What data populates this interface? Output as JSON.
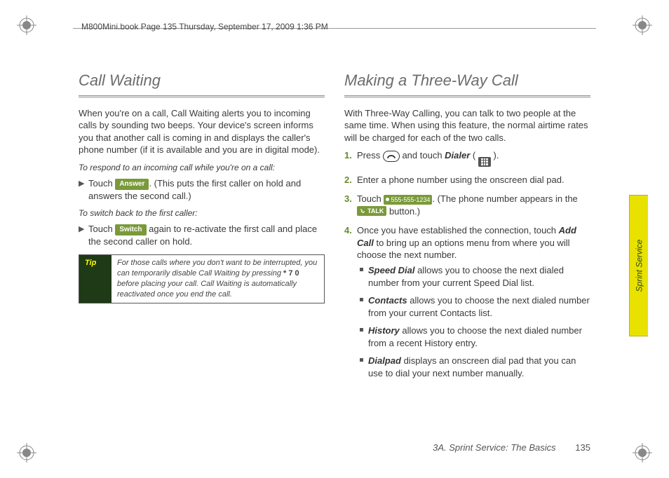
{
  "header": {
    "filename_line": "M800Mini.book  Page 135  Thursday, September 17, 2009  1:36 PM"
  },
  "side_tab": "Sprint Service",
  "footer": {
    "section": "3A. Sprint Service: The Basics",
    "page_no": "135"
  },
  "left": {
    "title": "Call Waiting",
    "intro": "When you're on a call, Call Waiting alerts you to incoming calls by sounding two beeps. Your device's screen informs you that another call is coming in and displays the caller's phone number (if it is available and you are in digital mode).",
    "sub1": "To respond to an incoming call while you're on a call:",
    "b1_a": "Touch ",
    "b1_btn": "Answer",
    "b1_b": ". (This puts the first caller on hold and answers the second call.)",
    "sub2": "To switch back to the first caller:",
    "b2_a": "Touch ",
    "b2_btn": "Switch",
    "b2_b": " again to re-activate the first call and place the second caller on hold.",
    "tip_label": "Tip",
    "tip_a": "For those calls where you don't want to be interrupted, you can temporarily disable Call Waiting by pressing ",
    "tip_code": "* 7 0",
    "tip_b": " before placing your call. Call Waiting is automatically reactivated once you end the call."
  },
  "right": {
    "title": "Making a Three-Way Call",
    "intro": "With Three-Way Calling, you can talk to two people at the same time. When using this feature, the normal airtime rates will be charged for each of the two calls.",
    "steps": {
      "s1_a": "Press ",
      "s1_b": " and touch ",
      "s1_dialer": "Dialer",
      "s1_c": " ( ",
      "s1_d": " ).",
      "s2": "Enter a phone number using the onscreen dial pad.",
      "s3_a": "Touch ",
      "s3_num": "555-555-1234",
      "s3_b": ". (The phone number appears in the ",
      "s3_talk": "TALK",
      "s3_c": " button.)",
      "s4_a": "Once you have established the connection, touch ",
      "s4_add": "Add Call",
      "s4_b": " to bring up an options menu from where you will choose the next number.",
      "opt1_lbl": "Speed Dial",
      "opt1_txt": " allows you to choose the next dialed number from your current Speed Dial list.",
      "opt2_lbl": "Contacts",
      "opt2_txt": " allows you to choose the next dialed number from your current Contacts list.",
      "opt3_lbl": "History",
      "opt3_txt": " allows you to choose the next dialed number from a recent History entry.",
      "opt4_lbl": "Dialpad",
      "opt4_txt": " displays an onscreen dial pad that you can use to dial your next number manually."
    }
  }
}
